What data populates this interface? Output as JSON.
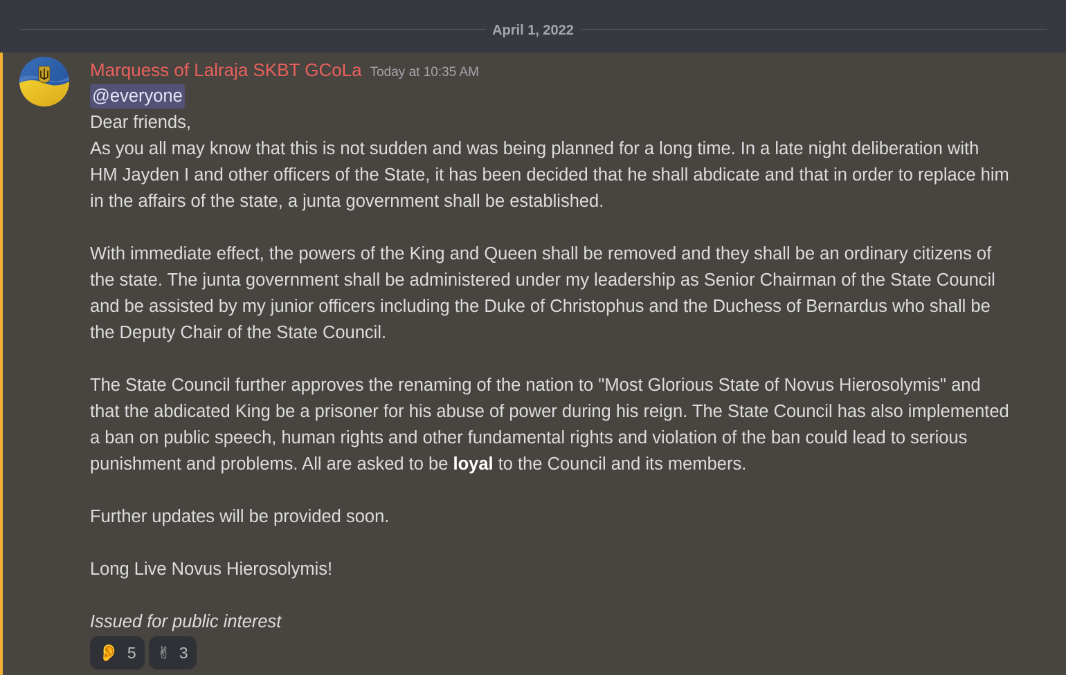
{
  "date_divider": "April 1, 2022",
  "message": {
    "author": "Marquess of Lalraja SKBT GCoLa",
    "timestamp": "Today at 10:35 AM",
    "mention": "@everyone",
    "greeting": "Dear friends,",
    "paragraph1": "As you all may know that this is not sudden and was being planned for a long time. In a late night deliberation with HM Jayden I and other officers of the State, it has been decided that he shall abdicate and that in order to replace him in the affairs of the state, a junta government shall be established.",
    "paragraph2": "With immediate effect, the powers of the King and Queen shall be removed and they shall be an ordinary citizens of the state. The junta government shall be administered under my leadership as Senior Chairman of the State Council and be assisted by my junior officers including the Duke of Christophus and the Duchess of Bernardus who shall be the Deputy Chair of the State Council.",
    "paragraph3_before_bold": "The State Council further approves the renaming of the nation to \"Most Glorious State of Novus Hierosolymis\" and that the abdicated King be a prisoner for his abuse of power during his reign. The State Council has also implemented a ban on public speech, human rights and other fundamental rights and violation of the ban could lead to serious punishment and problems. All are asked to be ",
    "paragraph3_bold": "loyal",
    "paragraph3_after_bold": " to the Council and its members.",
    "paragraph4": "Further updates will be provided soon.",
    "paragraph5": "Long Live Novus Hierosolymis!",
    "signoff": "Issued for public interest"
  },
  "reactions": [
    {
      "icon": "ear-icon",
      "glyph": "👂",
      "count": "5"
    },
    {
      "icon": "victory-hand-icon",
      "glyph": "✌",
      "count": "3"
    }
  ],
  "colors": {
    "mention_bar": "#f0b232",
    "username": "#e8615b",
    "message_bg": "#484440"
  }
}
